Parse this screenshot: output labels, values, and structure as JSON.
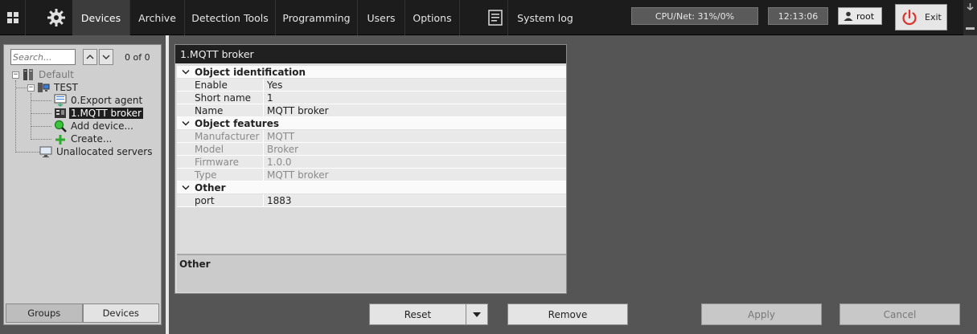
{
  "toolbar": {
    "tabs": [
      {
        "label": "Devices"
      },
      {
        "label": "Archive"
      },
      {
        "label": "Detection Tools"
      },
      {
        "label": "Programming"
      },
      {
        "label": "Users"
      },
      {
        "label": "Options"
      }
    ],
    "system_log": "System log",
    "cpu_net": "CPU/Net: 31%/0%",
    "clock": "12:13:06",
    "user": "root",
    "exit": "Exit"
  },
  "search": {
    "placeholder": "Search...",
    "count": "0 of 0"
  },
  "tree": {
    "items": [
      {
        "label": "Default"
      },
      {
        "label": "TEST"
      },
      {
        "label": "0.Export agent"
      },
      {
        "label": "1.MQTT broker"
      },
      {
        "label": "Add device..."
      },
      {
        "label": "Create..."
      },
      {
        "label": "Unallocated servers"
      }
    ]
  },
  "bottom_tabs": {
    "groups": "Groups",
    "devices": "Devices"
  },
  "properties": {
    "title": "1.MQTT broker",
    "sections": [
      {
        "title": "Object identification",
        "rows": [
          {
            "key": "Enable",
            "value": "Yes"
          },
          {
            "key": "Short name",
            "value": "1"
          },
          {
            "key": "Name",
            "value": "MQTT broker"
          }
        ]
      },
      {
        "title": "Object features",
        "rows": [
          {
            "key": "Manufacturer",
            "value": "MQTT"
          },
          {
            "key": "Model",
            "value": "Broker"
          },
          {
            "key": "Firmware",
            "value": "1.0.0"
          },
          {
            "key": "Type",
            "value": "MQTT broker"
          }
        ]
      },
      {
        "title": "Other",
        "rows": [
          {
            "key": "port",
            "value": "1883"
          }
        ]
      }
    ],
    "description": "Other"
  },
  "buttons": {
    "reset": "Reset",
    "remove": "Remove",
    "apply": "Apply",
    "cancel": "Cancel"
  },
  "colors": {
    "topbar": "#1c1c1c",
    "background": "#555555",
    "selected": "#1e1e1e",
    "exit_icon": "#d9342b"
  }
}
